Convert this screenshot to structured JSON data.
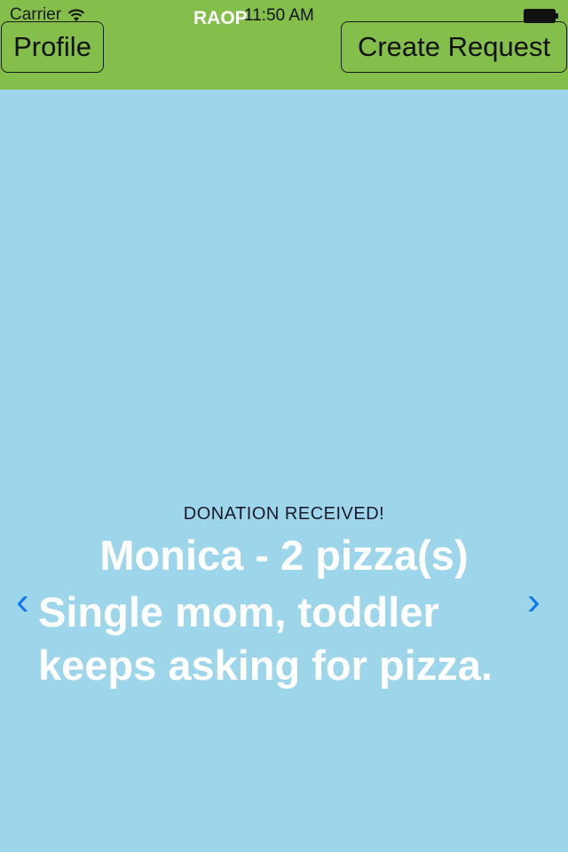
{
  "status_bar": {
    "carrier": "Carrier",
    "app_name": "RAOP",
    "time": "11:50 AM"
  },
  "nav": {
    "profile_label": "Profile",
    "create_request_label": "Create Request"
  },
  "request": {
    "status": "DONATION RECEIVED!",
    "title": "Monica - 2 pizza(s)",
    "description": "Single mom, toddler keeps asking for pizza."
  },
  "controls": {
    "prev_glyph": "‹",
    "next_glyph": "›"
  },
  "colors": {
    "header_green": "#84bf4b",
    "background_blue": "#9dd5ea",
    "arrow_blue": "#1278f0"
  }
}
